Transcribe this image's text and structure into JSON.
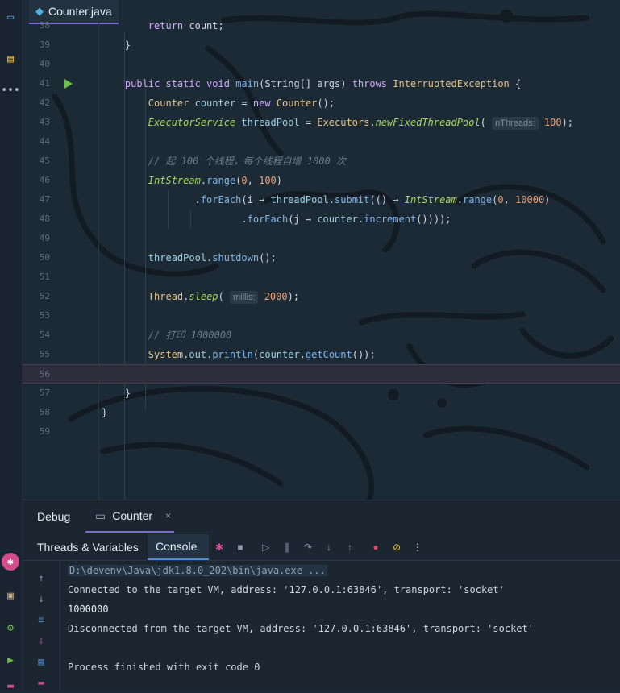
{
  "editor": {
    "tab": {
      "label": "Counter.java",
      "close": "×"
    },
    "lines": [
      {
        "n": "38",
        "segments": [
          {
            "t": "        "
          },
          {
            "t": "return",
            "c": "kw"
          },
          {
            "t": " count;"
          }
        ]
      },
      {
        "n": "39",
        "segments": [
          {
            "t": "    }"
          }
        ]
      },
      {
        "n": "40",
        "segments": []
      },
      {
        "n": "41",
        "run": true,
        "segments": [
          {
            "t": "    "
          },
          {
            "t": "public static void",
            "c": "kw"
          },
          {
            "t": " "
          },
          {
            "t": "main",
            "c": "fn"
          },
          {
            "t": "(String[] args) "
          },
          {
            "t": "throws",
            "c": "kw"
          },
          {
            "t": " "
          },
          {
            "t": "InterruptedException",
            "c": "ty"
          },
          {
            "t": " {"
          }
        ]
      },
      {
        "n": "42",
        "segments": [
          {
            "t": "        "
          },
          {
            "t": "Counter",
            "c": "ty"
          },
          {
            "t": " "
          },
          {
            "t": "counter",
            "c": "var"
          },
          {
            "t": " = "
          },
          {
            "t": "new",
            "c": "kw"
          },
          {
            "t": " "
          },
          {
            "t": "Counter",
            "c": "ty"
          },
          {
            "t": "();"
          }
        ]
      },
      {
        "n": "43",
        "segments": [
          {
            "t": "        "
          },
          {
            "t": "ExecutorService",
            "c": "it"
          },
          {
            "t": " "
          },
          {
            "t": "threadPool",
            "c": "var"
          },
          {
            "t": " = "
          },
          {
            "t": "Executors",
            "c": "ty"
          },
          {
            "t": "."
          },
          {
            "t": "newFixedThreadPool",
            "c": "it"
          },
          {
            "t": "( "
          },
          {
            "t": "nThreads:",
            "c": "hint"
          },
          {
            "t": " "
          },
          {
            "t": "100",
            "c": "num"
          },
          {
            "t": ");"
          }
        ]
      },
      {
        "n": "44",
        "segments": []
      },
      {
        "n": "45",
        "segments": [
          {
            "t": "        "
          },
          {
            "t": "// 起 100 个线程，每个线程自增 1000 次",
            "c": "cm"
          }
        ]
      },
      {
        "n": "46",
        "segments": [
          {
            "t": "        "
          },
          {
            "t": "IntStream",
            "c": "it"
          },
          {
            "t": "."
          },
          {
            "t": "range",
            "c": "fn"
          },
          {
            "t": "("
          },
          {
            "t": "0",
            "c": "num"
          },
          {
            "t": ", "
          },
          {
            "t": "100",
            "c": "num"
          },
          {
            "t": ")"
          }
        ]
      },
      {
        "n": "47",
        "segments": [
          {
            "t": "                ."
          },
          {
            "t": "forEach",
            "c": "fn"
          },
          {
            "t": "(i → "
          },
          {
            "t": "threadPool",
            "c": "var"
          },
          {
            "t": "."
          },
          {
            "t": "submit",
            "c": "fn"
          },
          {
            "t": "(() → "
          },
          {
            "t": "IntStream",
            "c": "it"
          },
          {
            "t": "."
          },
          {
            "t": "range",
            "c": "fn"
          },
          {
            "t": "("
          },
          {
            "t": "0",
            "c": "num"
          },
          {
            "t": ", "
          },
          {
            "t": "10000",
            "c": "num"
          },
          {
            "t": ")"
          }
        ]
      },
      {
        "n": "48",
        "segments": [
          {
            "t": "                        ."
          },
          {
            "t": "forEach",
            "c": "fn"
          },
          {
            "t": "(j → "
          },
          {
            "t": "counter",
            "c": "var"
          },
          {
            "t": "."
          },
          {
            "t": "increment",
            "c": "fn"
          },
          {
            "t": "())));"
          }
        ]
      },
      {
        "n": "49",
        "segments": []
      },
      {
        "n": "50",
        "segments": [
          {
            "t": "        "
          },
          {
            "t": "threadPool",
            "c": "var"
          },
          {
            "t": "."
          },
          {
            "t": "shutdown",
            "c": "fn"
          },
          {
            "t": "();"
          }
        ]
      },
      {
        "n": "51",
        "segments": []
      },
      {
        "n": "52",
        "segments": [
          {
            "t": "        "
          },
          {
            "t": "Thread",
            "c": "ty"
          },
          {
            "t": "."
          },
          {
            "t": "sleep",
            "c": "it"
          },
          {
            "t": "( "
          },
          {
            "t": "millis:",
            "c": "hint"
          },
          {
            "t": " "
          },
          {
            "t": "2000",
            "c": "num"
          },
          {
            "t": ");"
          }
        ]
      },
      {
        "n": "53",
        "segments": []
      },
      {
        "n": "54",
        "segments": [
          {
            "t": "        "
          },
          {
            "t": "// 打印 1000000",
            "c": "cm"
          }
        ]
      },
      {
        "n": "55",
        "segments": [
          {
            "t": "        "
          },
          {
            "t": "System",
            "c": "ty"
          },
          {
            "t": "."
          },
          {
            "t": "out",
            "c": "var"
          },
          {
            "t": "."
          },
          {
            "t": "println",
            "c": "fn"
          },
          {
            "t": "("
          },
          {
            "t": "counter",
            "c": "var"
          },
          {
            "t": "."
          },
          {
            "t": "getCount",
            "c": "fn"
          },
          {
            "t": "());"
          }
        ]
      },
      {
        "n": "56",
        "current": true,
        "segments": []
      },
      {
        "n": "57",
        "segments": [
          {
            "t": "    }"
          }
        ]
      },
      {
        "n": "58",
        "segments": [
          {
            "t": "}"
          }
        ]
      },
      {
        "n": "59",
        "segments": []
      }
    ]
  },
  "debug": {
    "title": "Debug",
    "session_tab": "Counter",
    "session_close": "×",
    "subtabs": [
      "Threads & Variables",
      "Console"
    ],
    "active_subtab": "Console",
    "console_lines": [
      "D:\\devenv\\Java\\jdk1.8.0_202\\bin\\java.exe ...",
      "Connected to the target VM, address: '127.0.0.1:63846', transport: 'socket'",
      "1000000",
      "Disconnected from the target VM, address: '127.0.0.1:63846', transport: 'socket'",
      "",
      "Process finished with exit code 0"
    ]
  },
  "colors": {
    "accent": "#7a6bd9",
    "run": "#6dc04e",
    "debug_badge": "#d34d8c"
  }
}
